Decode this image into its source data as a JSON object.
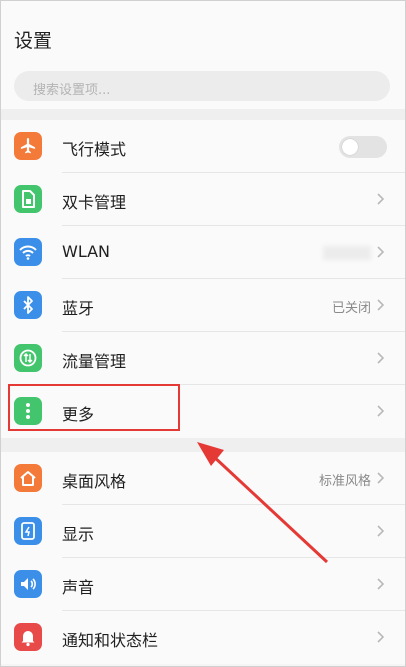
{
  "header": {
    "title": "设置"
  },
  "search": {
    "placeholder": "搜索设置项..."
  },
  "section1": [
    {
      "label": "飞行模式",
      "icon": "airplane-icon",
      "color": "#f47a3a",
      "control": "toggle",
      "toggle_on": false
    },
    {
      "label": "双卡管理",
      "icon": "sim-card-icon",
      "color": "#43c56d",
      "control": "chevron"
    },
    {
      "label": "WLAN",
      "icon": "wifi-icon",
      "color": "#3b8fe8",
      "control": "chevron"
    },
    {
      "label": "蓝牙",
      "icon": "bluetooth-icon",
      "color": "#3b8fe8",
      "value": "已关闭",
      "control": "chevron"
    },
    {
      "label": "流量管理",
      "icon": "data-traffic-icon",
      "color": "#43c56d",
      "control": "chevron"
    },
    {
      "label": "更多",
      "icon": "more-vertical-icon",
      "color": "#43c56d",
      "control": "chevron"
    }
  ],
  "section2": [
    {
      "label": "桌面风格",
      "icon": "home-icon",
      "color": "#f47a3a",
      "value": "标准风格",
      "control": "chevron"
    },
    {
      "label": "显示",
      "icon": "display-icon",
      "color": "#3b8fe8",
      "control": "chevron"
    },
    {
      "label": "声音",
      "icon": "speaker-icon",
      "color": "#3b8fe8",
      "control": "chevron"
    },
    {
      "label": "通知和状态栏",
      "icon": "bell-icon",
      "color": "#e84a4a",
      "control": "chevron"
    }
  ],
  "annotation": {
    "color": "#e53935"
  }
}
